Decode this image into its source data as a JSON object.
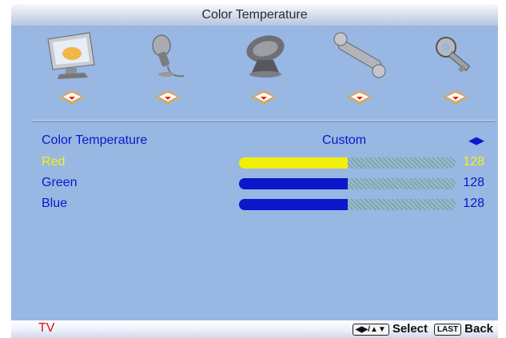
{
  "title": "Color Temperature",
  "menu_icons": [
    {
      "name": "picture-icon"
    },
    {
      "name": "audio-icon"
    },
    {
      "name": "tv-antenna-icon"
    },
    {
      "name": "setup-icon"
    },
    {
      "name": "parental-lock-icon"
    }
  ],
  "settings": {
    "color_temperature": {
      "label": "Color Temperature",
      "value": "Custom",
      "arrows": "◀▶"
    },
    "red": {
      "label": "Red",
      "value": "128",
      "level": 0.5,
      "color": "#f2ef0c"
    },
    "green": {
      "label": "Green",
      "value": "128",
      "level": 0.5,
      "color": "#0b17c8"
    },
    "blue": {
      "label": "Blue",
      "value": "128",
      "level": 0.5,
      "color": "#0b17c8"
    }
  },
  "footer": {
    "source": "TV",
    "nav_key": "◀▶/▲▼",
    "select_label": "Select",
    "back_key": "LAST",
    "back_label": "Back"
  },
  "colors": {
    "panel": "#98b7e3",
    "text": "#0b17c8",
    "selected": "#f6f20e",
    "source": "#e01010"
  }
}
